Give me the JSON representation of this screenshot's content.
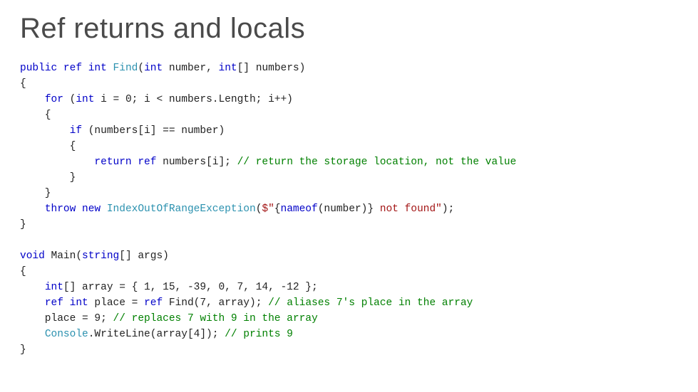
{
  "title": "Ref returns and locals",
  "code": {
    "l1": {
      "a": "public",
      "b": "ref",
      "c": "int",
      "d": "Find",
      "e": "int",
      "f": "number,",
      "g": "int",
      "h": "[] numbers)"
    },
    "l2": "{",
    "l3": {
      "a": "for",
      "b": "(",
      "c": "int",
      "d": " i = 0; i < numbers.Length; i++)"
    },
    "l4": "    {",
    "l5": {
      "a": "if",
      "b": " (numbers[i] == number)"
    },
    "l6": "        {",
    "l7": {
      "a": "return",
      "b": "ref",
      "c": " numbers[i]; ",
      "d": "// return the storage location, not the value"
    },
    "l8": "        }",
    "l9": "    }",
    "l10": {
      "a": "throw",
      "b": "new",
      "c": "IndexOutOfRangeException",
      "d": "(",
      "e": "$\"",
      "f": "{",
      "g": "nameof",
      "h": "(number)}",
      "i": " not found\"",
      "j": ");"
    },
    "l11": "}",
    "l12": "",
    "l13": {
      "a": "void",
      "b": " Main(",
      "c": "string",
      "d": "[] args)"
    },
    "l14": "{",
    "l15": {
      "a": "int",
      "b": "[] array = { 1, 15, -39, 0, 7, 14, -12 };"
    },
    "l16": {
      "a": "ref",
      "b": "int",
      "c": " place = ",
      "d": "ref",
      "e": " Find(7, array); ",
      "f": "// aliases 7's place in the array"
    },
    "l17": {
      "a": "    place = 9; ",
      "b": "// replaces 7 with 9 in the array"
    },
    "l18": {
      "a": "Console",
      "b": ".WriteLine(array[4]); ",
      "c": "// prints 9"
    },
    "l19": "}"
  }
}
